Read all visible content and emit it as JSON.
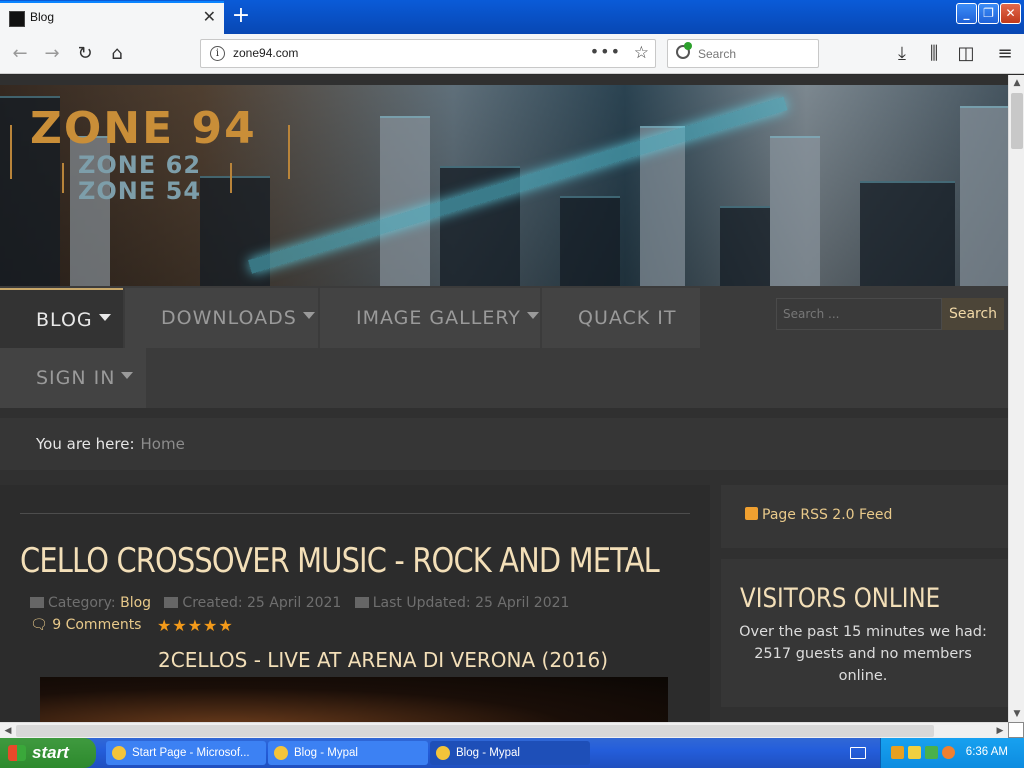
{
  "browser": {
    "tab_title": "Blog",
    "new_tab": "+",
    "url": "zone94.com",
    "url_actions": "•••",
    "search_placeholder": "Search"
  },
  "banner": {
    "logo_main": "ZONE 94",
    "logo_sub1": "ZONE 62",
    "logo_sub2": "ZONE 54"
  },
  "menu": {
    "items": [
      {
        "label": "BLOG"
      },
      {
        "label": "DOWNLOADS"
      },
      {
        "label": "IMAGE GALLERY"
      },
      {
        "label": "QUACK IT"
      },
      {
        "label": "SIGN IN"
      }
    ],
    "search_placeholder": "Search ...",
    "search_button": "Search"
  },
  "breadcrumb": {
    "label": "You are here:",
    "home": "Home"
  },
  "article": {
    "title": "CELLO CROSSOVER MUSIC - ROCK AND METAL",
    "category_label": "Category:",
    "category": "Blog",
    "created": "Created: 25 April 2021",
    "updated": "Last Updated: 25 April 2021",
    "comments": "9 Comments",
    "rating_stars": "★★★★★",
    "subtitle": "2CELLOS - LIVE AT ARENA DI VERONA (2016)"
  },
  "sidebar": {
    "rss": "Page RSS 2.0 Feed",
    "visitors_title": "VISITORS ONLINE",
    "visitors_text": "Over the past 15 minutes we had: 2517 guests and no members online."
  },
  "taskbar": {
    "start": "start",
    "tasks": [
      {
        "label": "Start Page - Microsof..."
      },
      {
        "label": "Blog - Mypal"
      },
      {
        "label": "Blog - Mypal"
      }
    ],
    "clock": "6:36 AM"
  },
  "colors": {
    "accent": "#e8c98a",
    "title": "#f3dfb8",
    "stars": "#f39a1a",
    "logo": "#c98e38"
  }
}
